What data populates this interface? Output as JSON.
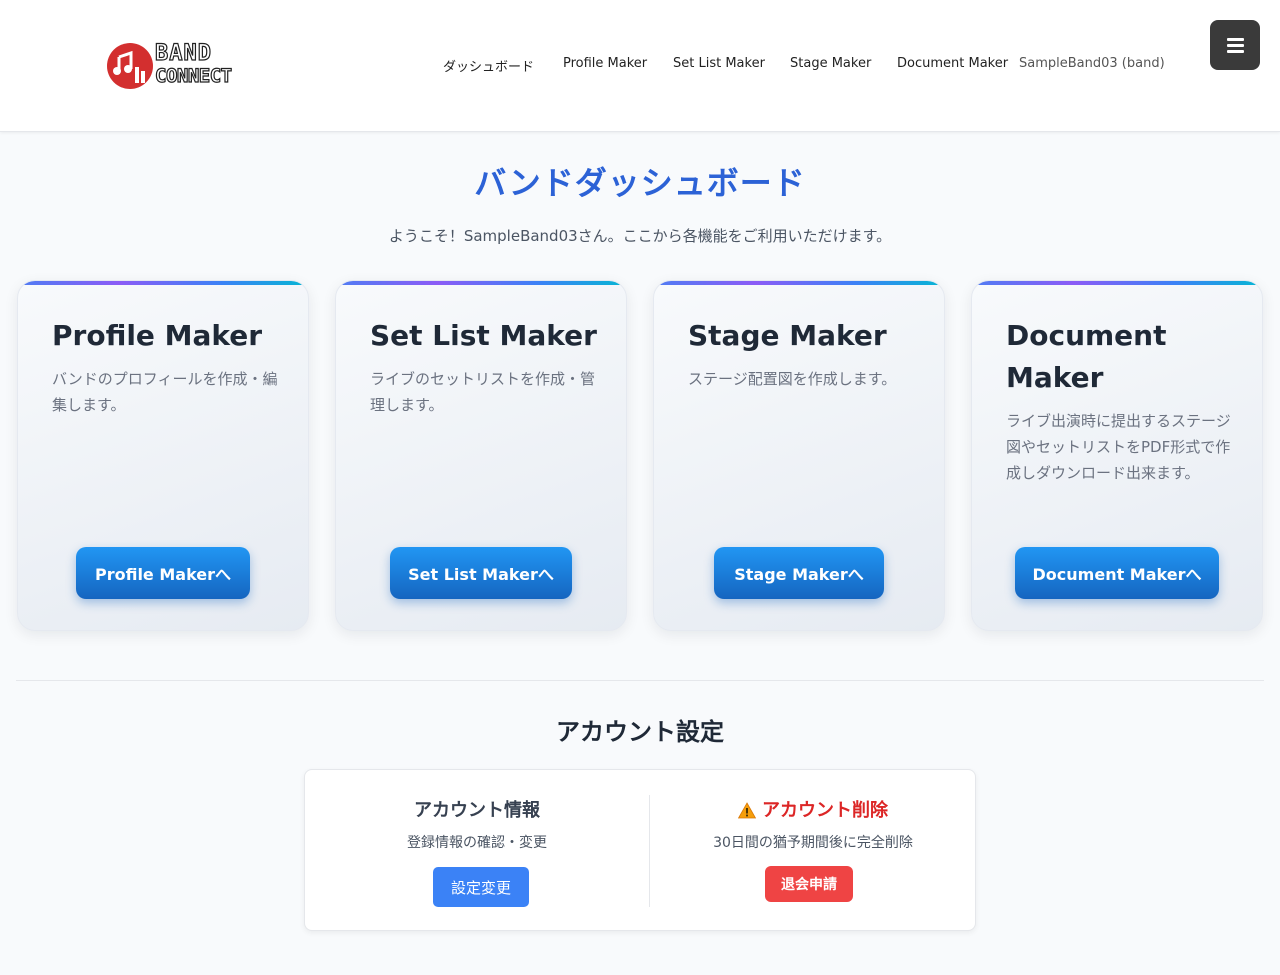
{
  "header": {
    "logo_line1": "BAND",
    "logo_line2": "CONNECT",
    "nav": [
      "ダッシュボード",
      "Profile Maker",
      "Set List Maker",
      "Stage Maker",
      "Document Maker"
    ],
    "user": "SampleBand03 (band)",
    "menu_icon": "hamburger-icon"
  },
  "page": {
    "title": "バンドダッシュボード",
    "welcome": "ようこそ！SampleBand03さん。ここから各機能をご利用いただけます。"
  },
  "cards": [
    {
      "title": "Profile Maker",
      "desc": "バンドのプロフィールを作成・編集します。",
      "button": "Profile Makerへ"
    },
    {
      "title": "Set List Maker",
      "desc": "ライブのセットリストを作成・管理します。",
      "button": "Set List Makerへ"
    },
    {
      "title": "Stage Maker",
      "desc": "ステージ配置図を作成します。",
      "button": "Stage Makerへ"
    },
    {
      "title": "Document Maker",
      "desc": "ライブ出演時に提出するステージ図やセットリストをPDF形式で作成しダウンロード出来ます。",
      "button": "Document Makerへ"
    }
  ],
  "account": {
    "section_title": "アカウント設定",
    "info": {
      "title": "アカウント情報",
      "desc": "登録情報の確認・変更",
      "button": "設定変更"
    },
    "delete": {
      "title": "アカウント削除",
      "desc": "30日間の猶予期間後に完全削除",
      "button": "退会申請",
      "icon": "warning-icon"
    }
  },
  "colors": {
    "accent": "#2c62d6",
    "button": "#1e88e5",
    "danger": "#ef4444",
    "logo": "#d32f2f"
  }
}
